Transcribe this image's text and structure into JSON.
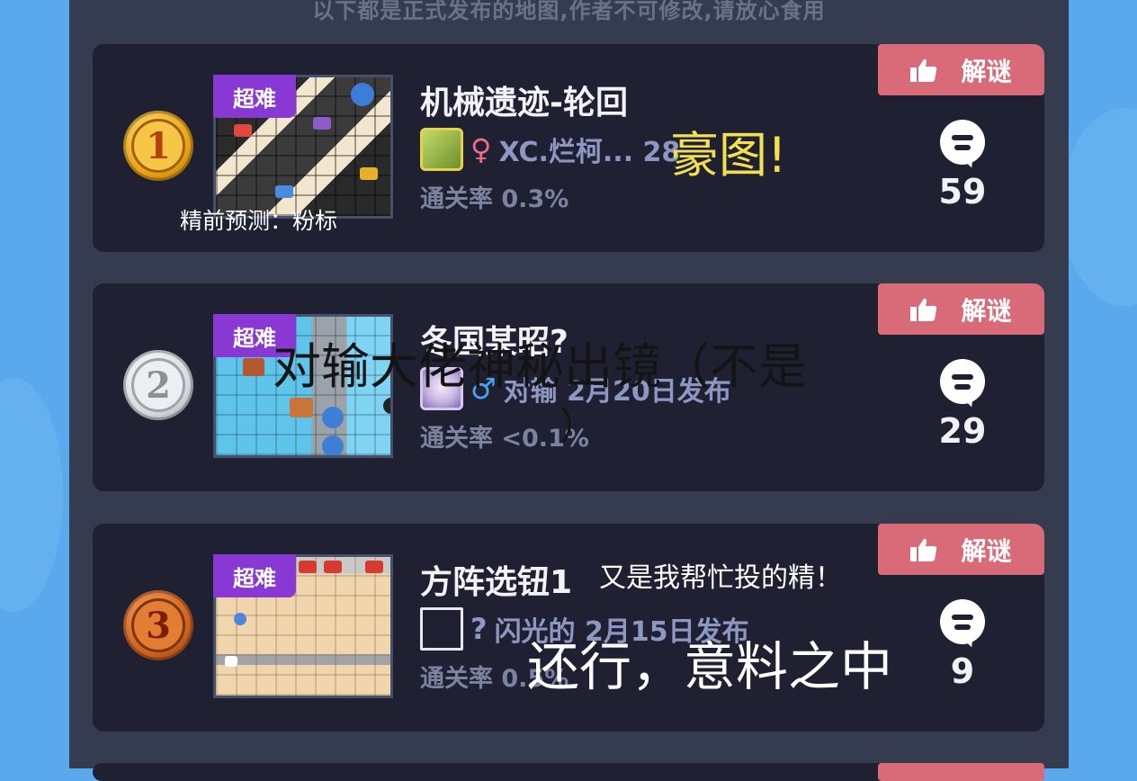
{
  "notice": "以下都是正式发布的地图,作者不可修改,请放心食用",
  "cards": [
    {
      "rank": "1",
      "medal": "gold",
      "badge": "超难",
      "title": "机械遗迹-轮回",
      "gender_icon": "♀",
      "author_line": "XC.烂柯... 28",
      "pass_rate": "通关率 0.3%",
      "solve_label": "解谜",
      "comments": "59"
    },
    {
      "rank": "2",
      "medal": "silver",
      "badge": "超难",
      "title": "冬国某昭?",
      "gender_icon": "♂",
      "author_line": "对输 2月20日发布",
      "pass_rate": "通关率 <0.1%",
      "solve_label": "解谜",
      "comments": "29"
    },
    {
      "rank": "3",
      "medal": "bronze",
      "badge": "超难",
      "title": "方阵选钮1",
      "gender_icon": "?",
      "author_line": "闪光的 2月15日发布",
      "pass_rate": "通关率 0.5%",
      "solve_label": "解谜",
      "comments": "9"
    }
  ],
  "overlays": {
    "jing": "精前预测：粉标",
    "hao": "豪图!",
    "dui_line1": "对输大佬神秘出镜（不是",
    "dui_line2": "）",
    "you": "又是我帮忙投的精！",
    "hai": "还行，意料之中"
  },
  "colors": {
    "panel": "#363c4f",
    "card": "#1f2133",
    "solve_button": "#d96b79",
    "badge": "#8a38d4",
    "background": "#5aa9ec"
  },
  "icons": {
    "thumb": "thumb-up-icon",
    "comment": "comment-bubble-icon"
  }
}
